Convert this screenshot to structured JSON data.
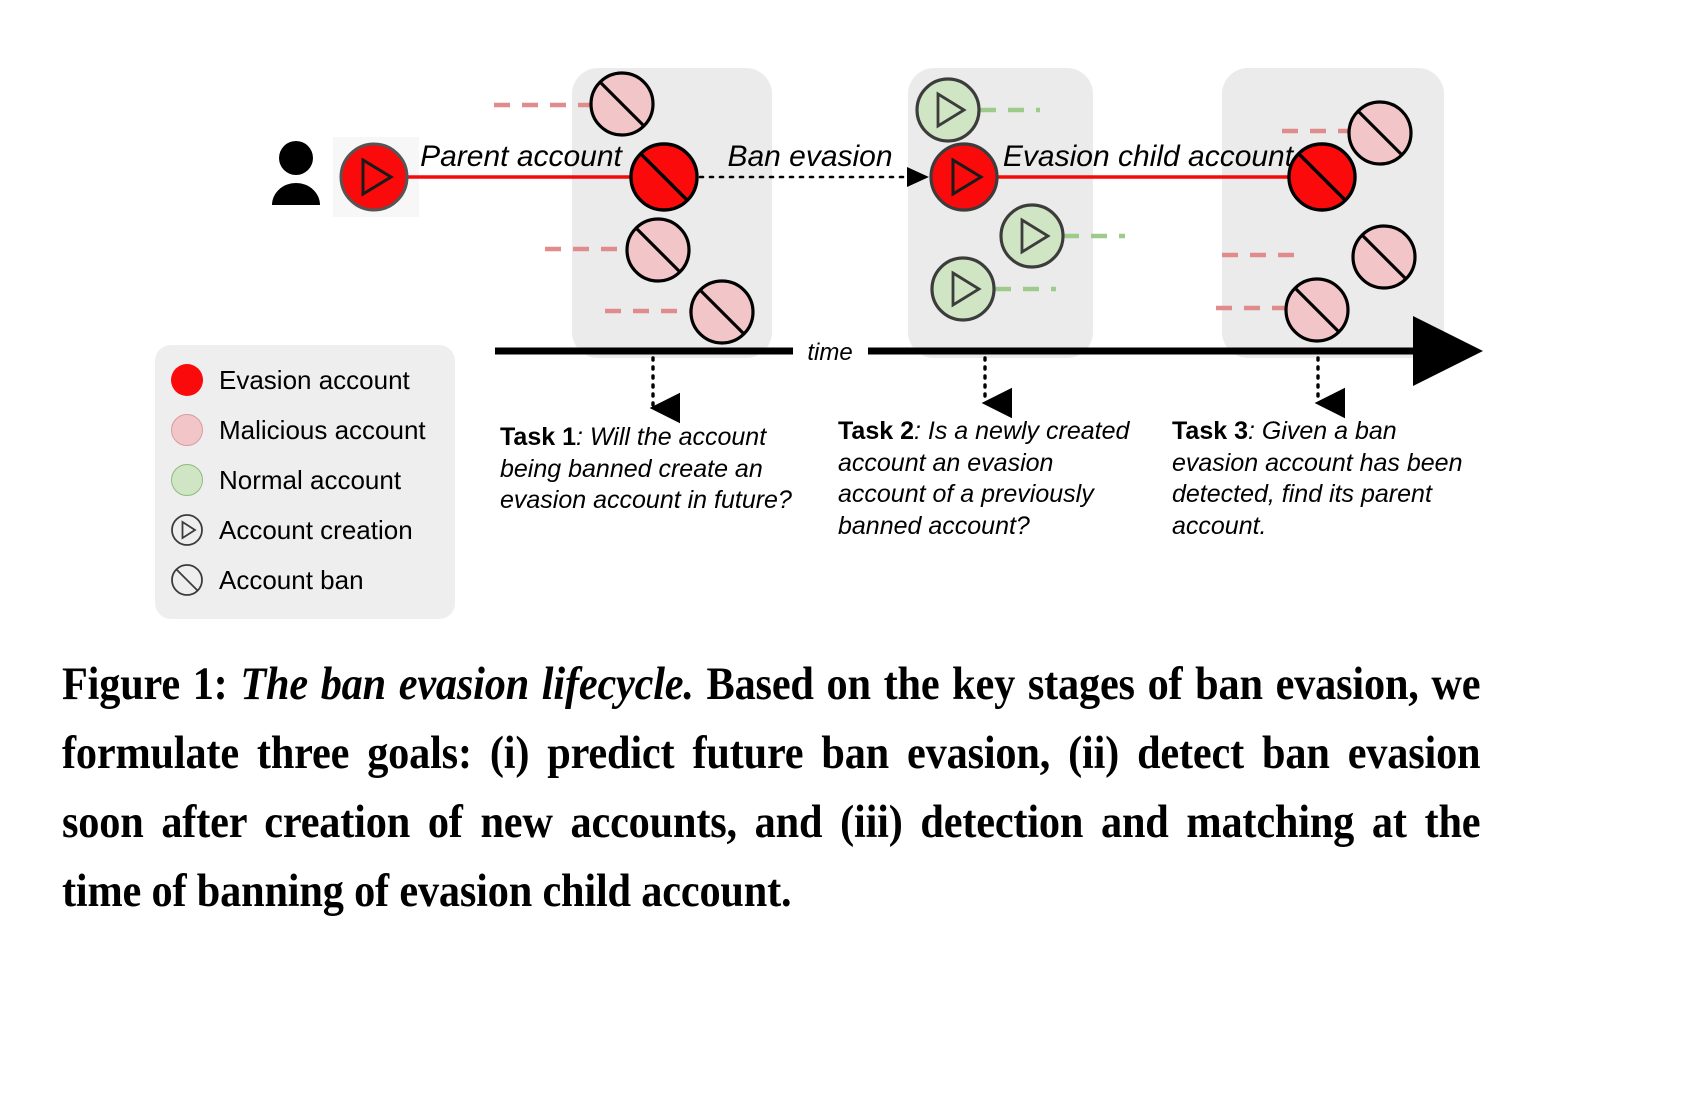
{
  "figure": {
    "diagram_labels": {
      "parent_account": "Parent account",
      "ban_evasion": "Ban evasion",
      "evasion_child_account": "Evasion child account",
      "time_axis": "time"
    },
    "legend": {
      "items": [
        {
          "icon": "filled-red-circle-icon",
          "label": "Evasion account",
          "color": "#fa0a0a"
        },
        {
          "icon": "filled-pink-circle-icon",
          "label": "Malicious account",
          "color": "#f2c6c8"
        },
        {
          "icon": "filled-green-circle-icon",
          "label": "Normal account",
          "color": "#cfe5c4"
        },
        {
          "icon": "play-triangle-in-circle-icon",
          "label": "Account creation",
          "color": "#000000"
        },
        {
          "icon": "ban-slash-in-circle-icon",
          "label": "Account ban",
          "color": "#000000"
        }
      ]
    },
    "tasks": [
      {
        "name": "Task 1",
        "separator": ": ",
        "text": "Will the account being banned create an evasion account in future?"
      },
      {
        "name": "Task 2",
        "separator": ": ",
        "text": "Is a newly created account an evasion account of a previously banned account?"
      },
      {
        "name": "Task 3",
        "separator": ": ",
        "text": "Given a ban evasion account has been detected, find its parent account."
      }
    ],
    "caption": {
      "label": "Figure 1:",
      "title": "The ban evasion lifecycle.",
      "body": "Based on the key stages of ban evasion, we formulate three goals: (i) predict future ban evasion, (ii) detect ban evasion soon after creation of new accounts, and (iii) detection and matching at the time of banning of evasion child account."
    },
    "colors": {
      "evasion_red": "#fa0a0a",
      "malicious_pink": "#f2c6c8",
      "normal_green": "#cfe5c4",
      "pink_dash": "#e08c8c",
      "green_dash": "#9ecb8c",
      "group_panel": "#ebebeb",
      "legend_panel": "#eeeeee",
      "axis_black": "#000000"
    }
  }
}
